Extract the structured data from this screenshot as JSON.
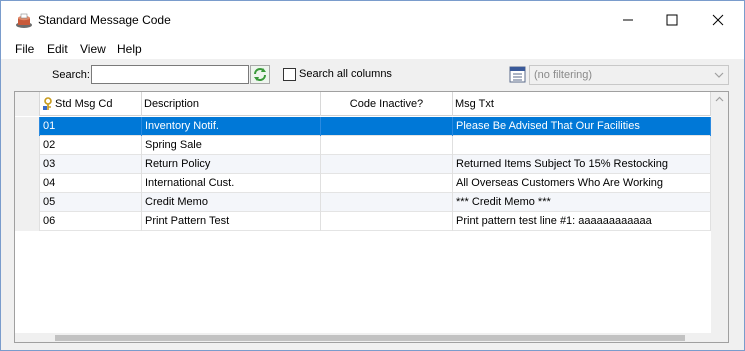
{
  "window": {
    "title": "Standard Message Code"
  },
  "menu": [
    {
      "label": "File"
    },
    {
      "label": "Edit"
    },
    {
      "label": "View"
    },
    {
      "label": "Help"
    }
  ],
  "toolbar": {
    "search_label": "Search:",
    "search_value": "",
    "search_all_label": "Search all columns",
    "search_all_checked": false,
    "filter_value": "(no filtering)"
  },
  "grid": {
    "columns": [
      "Std Msg Cd",
      "Description",
      "Code Inactive?",
      "Msg Txt"
    ],
    "rows": [
      {
        "code": "01",
        "description": "Inventory Notif.",
        "inactive": "",
        "msg": "Please Be Advised That Our Facilities"
      },
      {
        "code": "02",
        "description": "Spring Sale",
        "inactive": "",
        "msg": ""
      },
      {
        "code": "03",
        "description": "Return Policy",
        "inactive": "",
        "msg": "Returned Items Subject To 15% Restocking"
      },
      {
        "code": "04",
        "description": "International Cust.",
        "inactive": "",
        "msg": "All Overseas Customers Who Are Working"
      },
      {
        "code": "05",
        "description": "Credit Memo",
        "inactive": "",
        "msg": "*** Credit Memo ***"
      },
      {
        "code": "06",
        "description": "Print Pattern Test",
        "inactive": "",
        "msg": "Print pattern test line #1: aaaaaaaaaaaa"
      }
    ],
    "selected_row": 0
  },
  "colors": {
    "selection": "#0078d7",
    "window_border": "#7a9ccc"
  }
}
